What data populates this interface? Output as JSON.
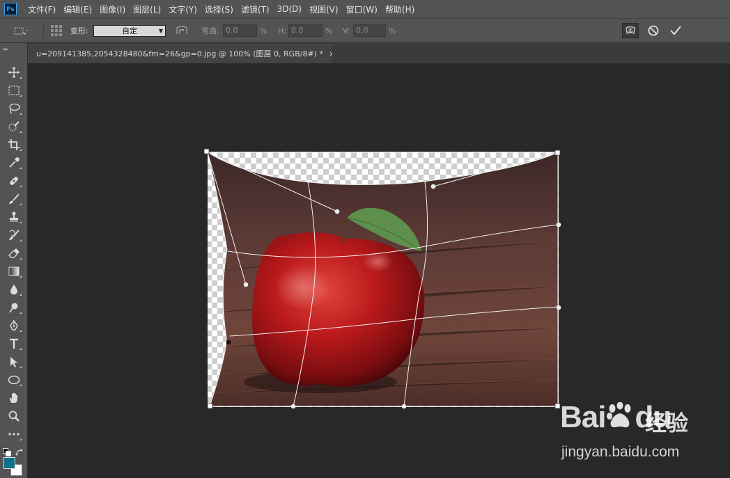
{
  "app": {
    "logo_text": "Ps"
  },
  "menu": {
    "items": [
      {
        "label": "文件(F)"
      },
      {
        "label": "编辑(E)"
      },
      {
        "label": "图像(I)"
      },
      {
        "label": "图层(L)"
      },
      {
        "label": "文字(Y)"
      },
      {
        "label": "选择(S)"
      },
      {
        "label": "滤镜(T)"
      },
      {
        "label": "3D(D)"
      },
      {
        "label": "视图(V)"
      },
      {
        "label": "窗口(W)"
      },
      {
        "label": "帮助(H)"
      }
    ]
  },
  "options": {
    "warp_label": "变形:",
    "warp_value": "自定",
    "bend_label": "弯曲:",
    "bend_value": "0.0",
    "h_label": "H:",
    "h_value": "0.0",
    "v_label": "V:",
    "v_value": "0.0",
    "percent": "%",
    "icons": {
      "reference": "reference-point-icon",
      "grid": "reference-grid-icon",
      "orientation": "warp-orientation-icon",
      "mode": "warp-mode-icon",
      "cancel": "cancel-icon",
      "commit": "checkmark-icon"
    }
  },
  "document": {
    "tab_title": "u=209141385,2054328480&fm=26&gp=0.jpg @ 100% (图层 0, RGB/8#) *",
    "close_glyph": "×"
  },
  "tools": [
    {
      "name": "move-tool"
    },
    {
      "name": "rectangular-marquee-tool"
    },
    {
      "name": "lasso-tool"
    },
    {
      "name": "quick-selection-tool"
    },
    {
      "name": "crop-tool"
    },
    {
      "name": "eyedropper-tool"
    },
    {
      "name": "healing-brush-tool"
    },
    {
      "name": "brush-tool"
    },
    {
      "name": "clone-stamp-tool"
    },
    {
      "name": "history-brush-tool"
    },
    {
      "name": "eraser-tool"
    },
    {
      "name": "gradient-tool"
    },
    {
      "name": "blur-tool"
    },
    {
      "name": "dodge-tool"
    },
    {
      "name": "pen-tool"
    },
    {
      "name": "type-tool"
    },
    {
      "name": "path-selection-tool"
    },
    {
      "name": "ellipse-tool"
    },
    {
      "name": "hand-tool"
    },
    {
      "name": "zoom-tool"
    },
    {
      "name": "more-tools"
    }
  ],
  "colors": {
    "foreground": "#0e6f86",
    "background": "#ffffff",
    "apple_red": "#b8161b",
    "wood_brown": "#6a4038",
    "leaf_green": "#5a8a4a"
  },
  "watermark": {
    "brand": "Bai",
    "brand_suffix": "du",
    "product": "经验",
    "url": "jingyan.baidu.com"
  }
}
